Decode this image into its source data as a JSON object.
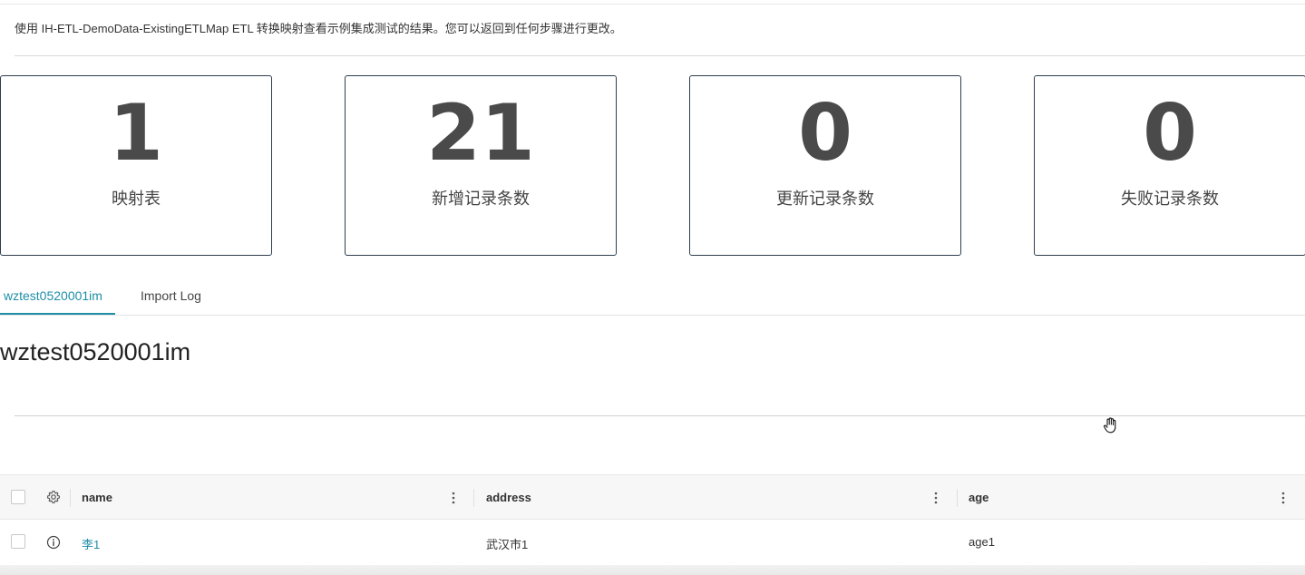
{
  "intro": {
    "text": "使用 IH-ETL-DemoData-ExistingETLMap ETL 转换映射查看示例集成测试的结果。您可以返回到任何步骤进行更改。"
  },
  "stats": [
    {
      "value": "1",
      "label": "映射表"
    },
    {
      "value": "21",
      "label": "新增记录条数"
    },
    {
      "value": "0",
      "label": "更新记录条数"
    },
    {
      "value": "0",
      "label": "失败记录条数"
    }
  ],
  "tabs": [
    {
      "label": "wztest0520001im",
      "active": true
    },
    {
      "label": "Import Log",
      "active": false
    }
  ],
  "section": {
    "title": "wztest0520001im"
  },
  "grid": {
    "columns": [
      "name",
      "address",
      "age"
    ],
    "rows": [
      {
        "name": "李1",
        "address": "武汉市1",
        "age": "age1"
      }
    ]
  },
  "colors": {
    "accent": "#1e8ea7",
    "card_border": "#2e3e4e",
    "stat_text": "#4a4a4a"
  },
  "icons": [
    "settings-gear-icon",
    "info-circle-icon",
    "kebab-menu-icon",
    "hand-cursor-icon"
  ]
}
